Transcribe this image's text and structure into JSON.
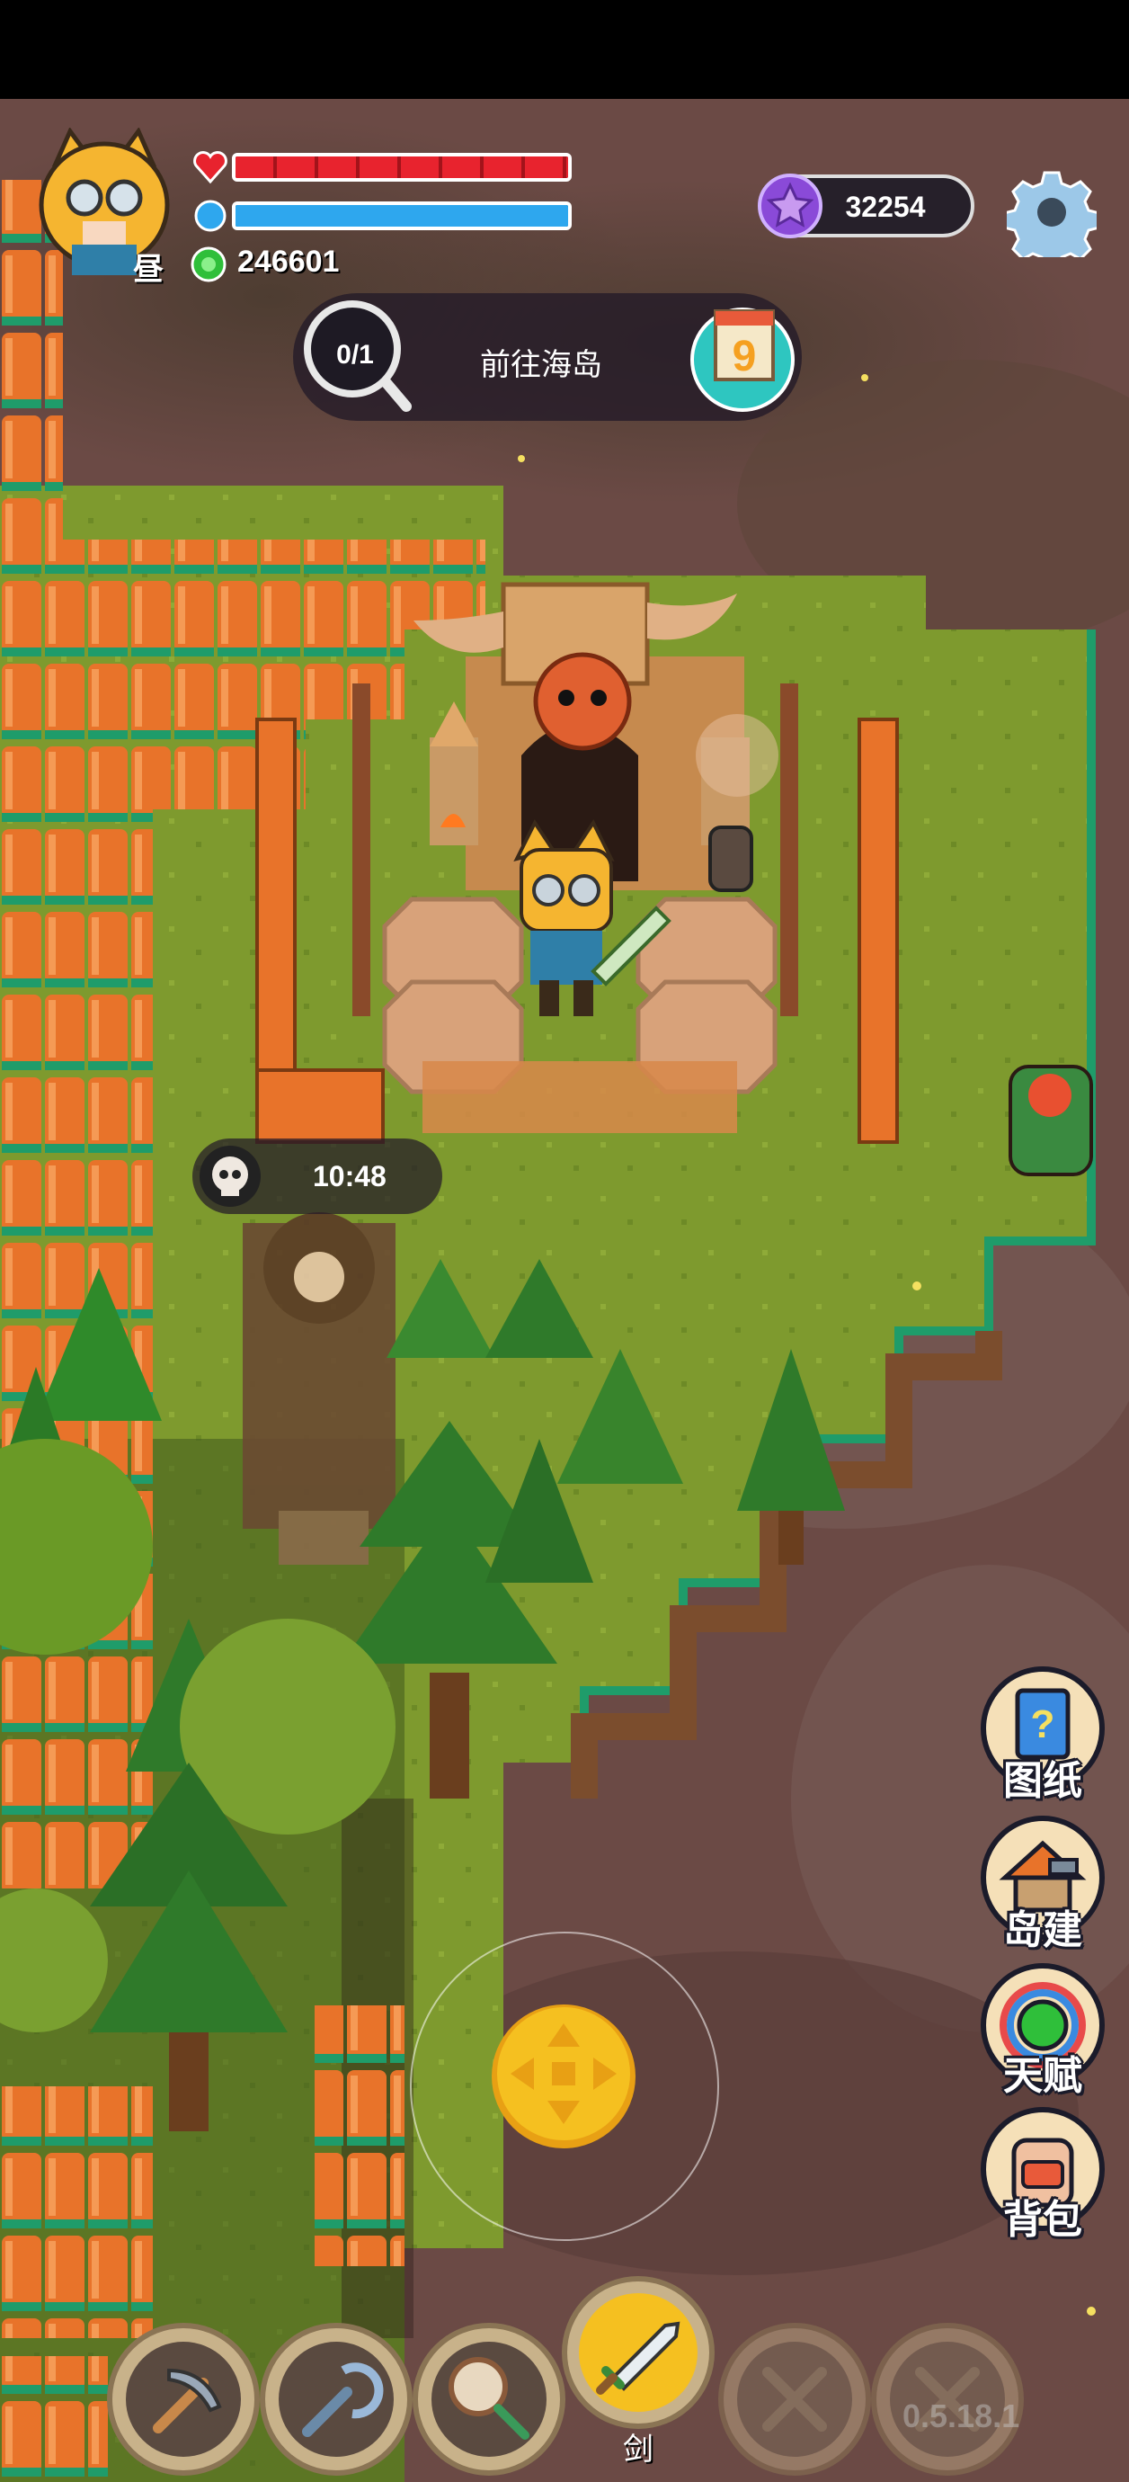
{
  "player": {
    "time_of_day": "昼",
    "health_ratio": 1.0,
    "mana_ratio": 1.0,
    "coins": "246601"
  },
  "currency": {
    "amount": "32254",
    "icon": "star-gem-icon"
  },
  "quest": {
    "progress": "0/1",
    "text": "前往海岛",
    "calendar_day": "9"
  },
  "event_timer": {
    "time": "10:48",
    "icon": "skull-icon"
  },
  "side_menu": [
    {
      "label": "图纸",
      "icon": "blueprint-icon"
    },
    {
      "label": "岛建",
      "icon": "island-build-icon"
    },
    {
      "label": "天赋",
      "icon": "talent-icon"
    },
    {
      "label": "背包",
      "icon": "backpack-icon"
    }
  ],
  "tools": [
    {
      "icon": "pickaxe-icon",
      "label": ""
    },
    {
      "icon": "hookshot-icon",
      "label": ""
    },
    {
      "icon": "net-icon",
      "label": ""
    },
    {
      "icon": "sword-icon",
      "label": "剑",
      "selected": true
    },
    {
      "icon": "locked-slot-icon",
      "label": ""
    },
    {
      "icon": "locked-slot-icon",
      "label": ""
    }
  ],
  "version": "0.5.18.1",
  "colors": {
    "health": "#e8232e",
    "mana": "#2ea7ee",
    "grass": "#7e9a2e",
    "cliff_bg": "#6b4a45",
    "fence": "#e8732a"
  }
}
